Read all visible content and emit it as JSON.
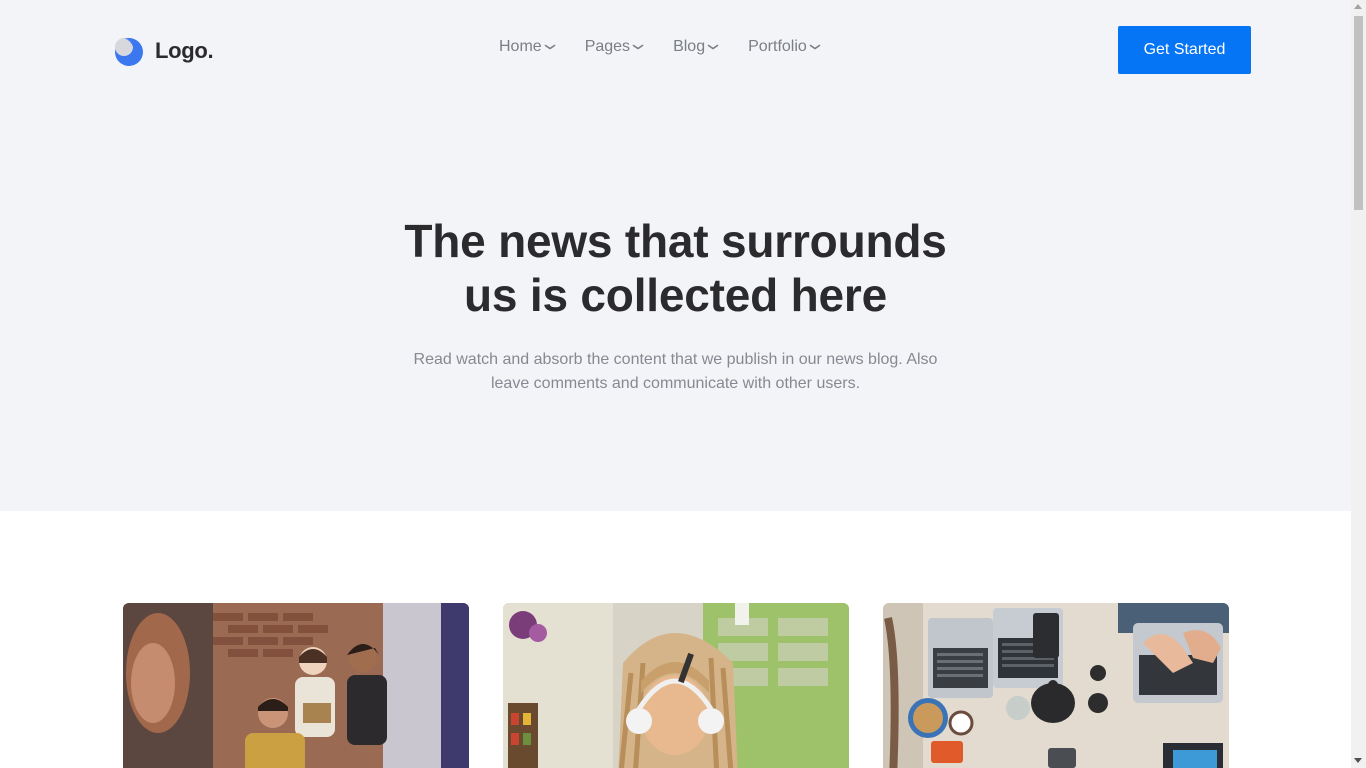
{
  "header": {
    "logo_text": "Logo.",
    "nav": [
      {
        "label": "Home"
      },
      {
        "label": "Pages"
      },
      {
        "label": "Blog"
      },
      {
        "label": "Portfolio"
      }
    ],
    "cta_label": "Get Started"
  },
  "hero": {
    "title_line1": "The news that surrounds",
    "title_line2": "us is collected here",
    "subtitle_line1": "Read watch and absorb the content that we publish in our news blog. Also",
    "subtitle_line2": "leave comments and communicate with other users."
  },
  "cards": [
    {
      "image": "photo-people-reading-office"
    },
    {
      "image": "photo-woman-headphones"
    },
    {
      "image": "photo-desk-laptops-overhead"
    }
  ],
  "colors": {
    "accent": "#0575f5",
    "hero_bg": "#f3f4f7",
    "heading": "#2b2b2e",
    "muted": "#868991"
  }
}
